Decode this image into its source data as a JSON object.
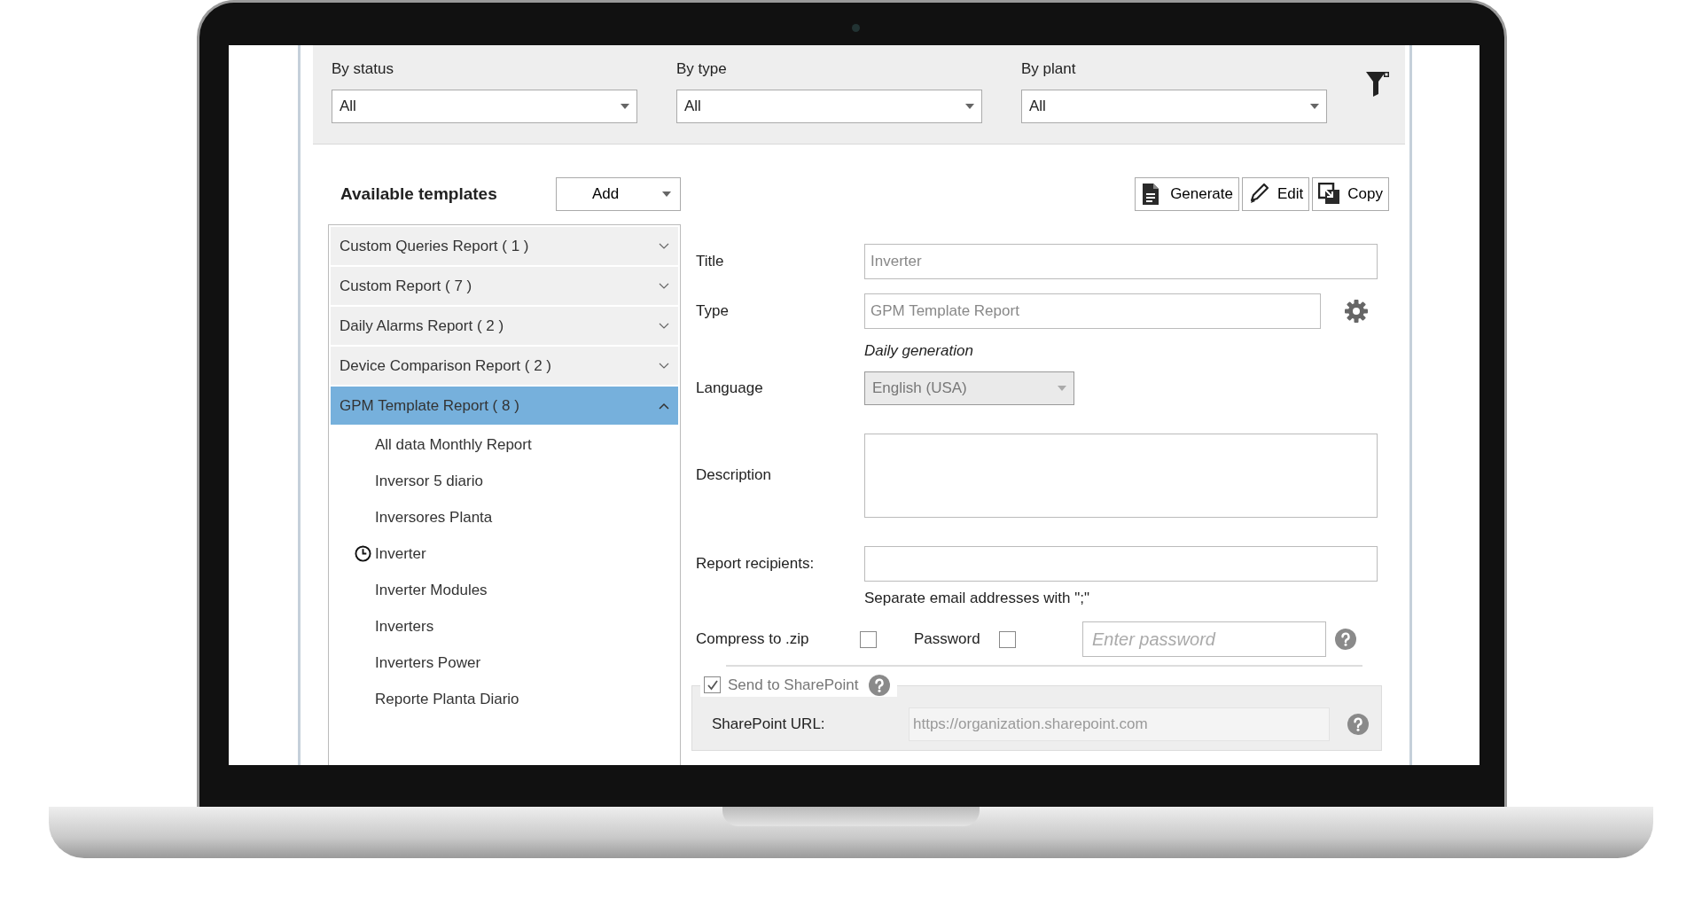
{
  "filters": [
    {
      "label": "By status",
      "value": "All"
    },
    {
      "label": "By type",
      "value": "All"
    },
    {
      "label": "By plant",
      "value": "All"
    }
  ],
  "templates": {
    "title": "Available templates",
    "add_button": "Add",
    "groups": [
      {
        "label": "Custom Queries Report  ( 1 )",
        "expanded": false,
        "selected": false
      },
      {
        "label": "Custom Report  ( 7 )",
        "expanded": false,
        "selected": false
      },
      {
        "label": "Daily Alarms Report  ( 2 )",
        "expanded": false,
        "selected": false
      },
      {
        "label": "Device Comparison Report  ( 2 )",
        "expanded": false,
        "selected": false
      },
      {
        "label": "GPM Template Report  ( 8 )",
        "expanded": true,
        "selected": true,
        "children": [
          {
            "label": "All data Monthly Report",
            "scheduled": false
          },
          {
            "label": "Inversor 5 diario",
            "scheduled": false
          },
          {
            "label": "Inversores Planta",
            "scheduled": false
          },
          {
            "label": "Inverter",
            "scheduled": true
          },
          {
            "label": "Inverter Modules",
            "scheduled": false
          },
          {
            "label": "Inverters",
            "scheduled": false
          },
          {
            "label": "Inverters Power",
            "scheduled": false
          },
          {
            "label": "Reporte Planta Diario",
            "scheduled": false
          }
        ]
      }
    ]
  },
  "actions": [
    {
      "kind": "generate",
      "label": "Generate"
    },
    {
      "kind": "edit",
      "label": "Edit"
    },
    {
      "kind": "copy",
      "label": "Copy"
    }
  ],
  "form": {
    "title": {
      "label": "Title",
      "value": "Inverter"
    },
    "type": {
      "label": "Type",
      "value": "GPM Template Report",
      "note": "Daily generation"
    },
    "language": {
      "label": "Language",
      "value": "English (USA)",
      "disabled": true
    },
    "description": {
      "label": "Description"
    },
    "recipients": {
      "label": "Report recipients:",
      "hint": "Separate email addresses with \";\""
    },
    "compress": {
      "label": "Compress to .zip",
      "checked": false
    },
    "password": {
      "label": "Password",
      "checked": false,
      "placeholder": "Enter password"
    },
    "sharepoint": {
      "label": "Send to SharePoint",
      "checked": true,
      "url_label": "SharePoint URL:",
      "url_placeholder": "https://organization.sharepoint.com"
    }
  }
}
